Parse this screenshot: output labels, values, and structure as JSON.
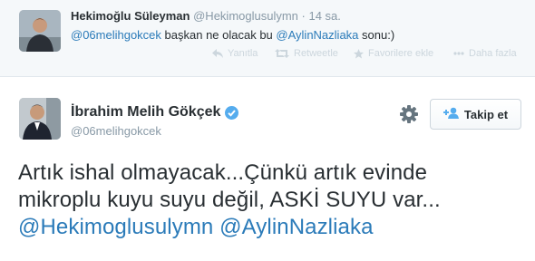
{
  "reply": {
    "name": "Hekimoğlu Süleyman",
    "handle": "@Hekimoglusulymn",
    "time": "· 14 sa.",
    "mention1": "@06melihgokcek",
    "text_mid": " başkan ne olacak bu ",
    "mention2": "@AylinNazliaka",
    "text_end": " sonu:)",
    "actions": {
      "reply_label": "Yanıtla",
      "retweet_label": "Retweetle",
      "favorite_label": "Favorilere ekle",
      "more_label": "Daha fazla"
    }
  },
  "tweet": {
    "name": "İbrahim Melih Gökçek",
    "handle": "@06melihgokcek",
    "follow_label": "Takip et",
    "line1": "Artık ishal olmayacak...Çünkü artık evinde",
    "line2": "mikroplu kuyu suyu değil, ASKİ SUYU var...",
    "mention1": "@Hekimoglusulymn",
    "mention2": "@AylinNazliaka"
  },
  "icons": {
    "verified": "verified-badge-icon",
    "gear": "gear-icon",
    "follow": "add-user-icon",
    "reply": "reply-icon",
    "retweet": "retweet-icon",
    "favorite": "star-icon",
    "more": "more-dots-icon"
  },
  "colors": {
    "link": "#2b7bb9",
    "verified": "#55acee",
    "muted": "#8899a6",
    "actions": "#ccd6dd"
  }
}
